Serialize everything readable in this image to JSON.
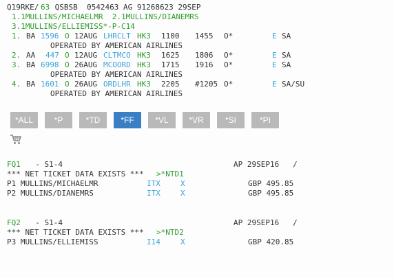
{
  "header": {
    "rec": "Q19RKE/",
    "seq": "63",
    "rest": " QSBSB  0542463 AG 91268623 29SEP",
    "pax_line1": "1.1MULLINS/MICHAELMR  2.1MULLINS/DIANEMRS",
    "pax_line2": "3.1MULLINS/ELLIEMISS*-P-C14"
  },
  "segments": [
    {
      "num": "1.",
      "carrier": "BA",
      "flight": "1596",
      "cls": "O",
      "date": "12AUG",
      "route": "LHRCLT",
      "status": "HK3",
      "dep": "1100",
      "arr": "1455",
      "meal": "O*",
      "e": "E",
      "tail": "SA",
      "operated": "OPERATED BY AMERICAN AIRLINES"
    },
    {
      "num": "2.",
      "carrier": "AA",
      "flight": "447",
      "cls": "O",
      "date": "12AUG",
      "route": "CLTMCO",
      "status": "HK3",
      "dep": "1625",
      "arr": "1806",
      "meal": "O*",
      "e": "E",
      "tail": "SA",
      "operated": ""
    },
    {
      "num": "3.",
      "carrier": "BA",
      "flight": "6998",
      "cls": "O",
      "date": "26AUG",
      "route": "MCOORD",
      "status": "HK3",
      "dep": "1715",
      "arr": "1916",
      "meal": "O*",
      "e": "E",
      "tail": "SA",
      "operated": "OPERATED BY AMERICAN AIRLINES"
    },
    {
      "num": "4.",
      "carrier": "BA",
      "flight": "1601",
      "cls": "O",
      "date": "26AUG",
      "route": "ORDLHR",
      "status": "HK3",
      "dep": "2205",
      "arr": "#1205",
      "meal": "O*",
      "e": "E",
      "tail": "SA/SU",
      "operated": "OPERATED BY AMERICAN AIRLINES"
    }
  ],
  "toolbar": {
    "buttons": [
      "*ALL",
      "*P",
      "*TD",
      "*FF",
      "*VL",
      "*VR",
      "*SI",
      "*PI"
    ],
    "active": "*FF",
    "cart_icon": "shopping-cart-icon"
  },
  "fares": [
    {
      "id": "FQ1",
      "segs": "  - S1-4",
      "ap": "AP 29SEP16   /",
      "net_text": "*** NET TICKET DATA EXISTS *** ",
      "net_link": ">*NTD1",
      "pax": [
        {
          "name": "P1 MULLINS/MICHAELMR",
          "type": "ITX",
          "x": "X",
          "amount": "GBP 495.85"
        },
        {
          "name": "P2 MULLINS/DIANEMRS",
          "type": "ITX",
          "x": "X",
          "amount": "GBP 495.85"
        }
      ]
    },
    {
      "id": "FQ2",
      "segs": "  - S1-4",
      "ap": "AP 29SEP16   /",
      "net_text": "*** NET TICKET DATA EXISTS *** ",
      "net_link": ">*NTD2",
      "pax": [
        {
          "name": "P3 MULLINS/ELLIEMISS",
          "type": "I14",
          "x": "X",
          "amount": "GBP 420.85"
        }
      ]
    }
  ],
  "colors": {
    "green": "#2e9b2e",
    "blue": "#3ba2dc",
    "button": "#b9b9b9",
    "button_active": "#3a7fc4"
  }
}
